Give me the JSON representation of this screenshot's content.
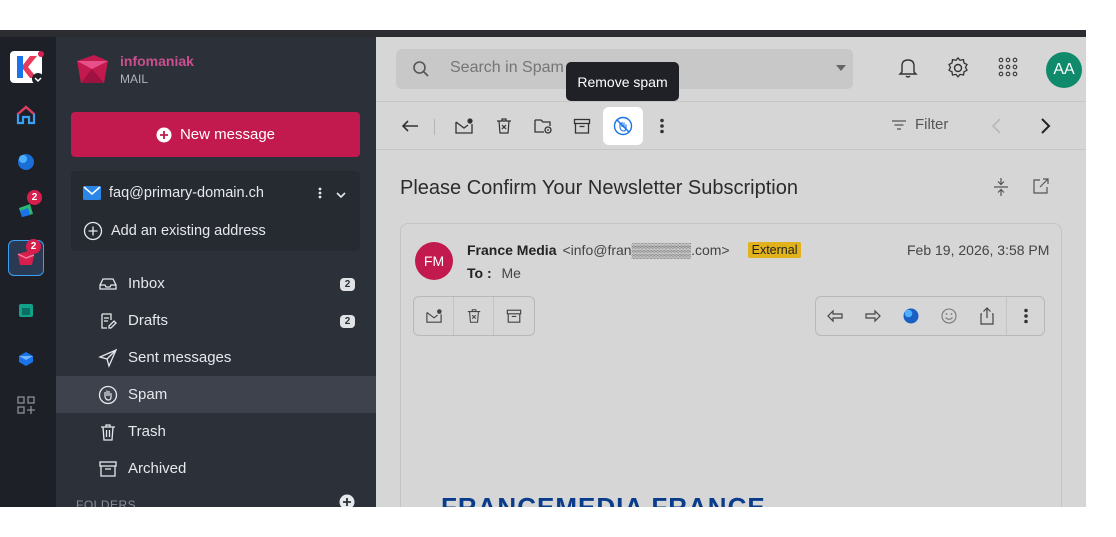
{
  "brand": {
    "name": "infomaniak",
    "product": "MAIL"
  },
  "rail": {
    "badges": [
      "2",
      "2"
    ]
  },
  "compose": {
    "label": "New message"
  },
  "account": {
    "email": "faq@primary-domain.ch",
    "add_label": "Add an existing address"
  },
  "folders": [
    {
      "label": "Inbox",
      "count": "2"
    },
    {
      "label": "Drafts",
      "count": "2"
    },
    {
      "label": "Sent messages",
      "count": ""
    },
    {
      "label": "Spam",
      "count": ""
    },
    {
      "label": "Trash",
      "count": ""
    },
    {
      "label": "Archived",
      "count": ""
    }
  ],
  "folders_header": "FOLDERS",
  "search": {
    "placeholder": "Search in Spam"
  },
  "user": {
    "initials": "AA"
  },
  "toolbar": {
    "tooltip": "Remove spam",
    "filter_label": "Filter"
  },
  "message": {
    "subject": "Please Confirm Your Newsletter Subscription",
    "sender_initials": "FM",
    "sender_name": "France Media",
    "sender_email": "<info@fran▒▒▒▒▒▒.com>",
    "badge": "External",
    "date": "Feb 19, 2026, 3:58 PM",
    "to_label": "To :",
    "to_value": "Me",
    "footer_logo_text": "FRANCEMEDIA  FRANCE"
  },
  "colors": {
    "accent": "#c21a4f",
    "panel": "#2c3039",
    "rail": "#1d2026",
    "badge_external": "#e1b21c",
    "avatar": "#0f8a6b"
  }
}
